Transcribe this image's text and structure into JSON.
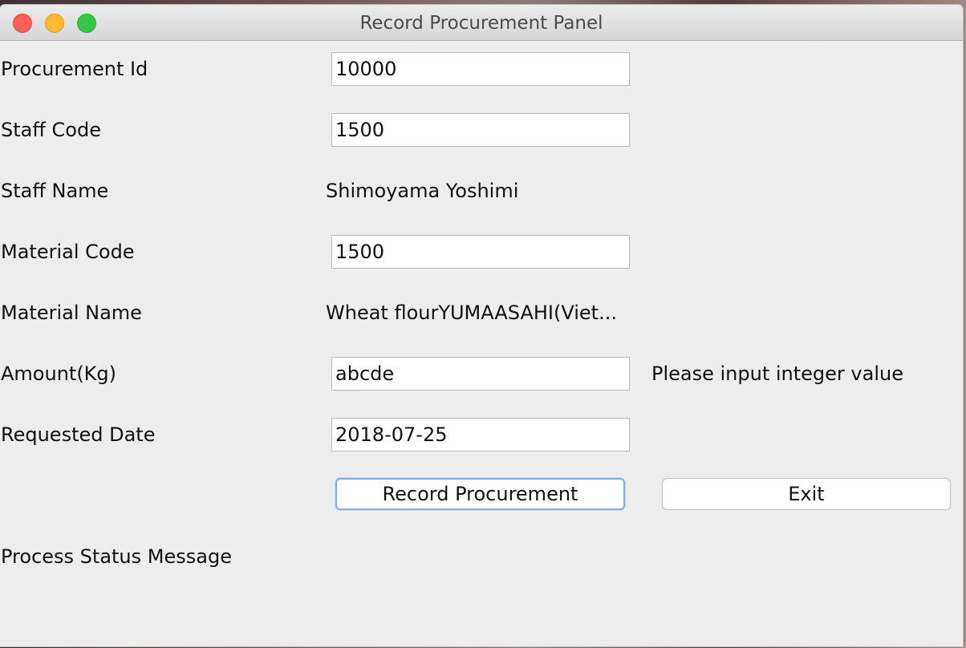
{
  "window": {
    "title": "Record Procurement Panel"
  },
  "form": {
    "procurement_id": {
      "label": "Procurement Id",
      "value": "10000"
    },
    "staff_code": {
      "label": "Staff Code",
      "value": "1500"
    },
    "staff_name": {
      "label": "Staff Name",
      "value": "Shimoyama Yoshimi"
    },
    "material_code": {
      "label": "Material Code",
      "value": "1500"
    },
    "material_name": {
      "label": "Material Name",
      "value": "Wheat flourYUMAASAHI(Viet..."
    },
    "amount": {
      "label": "Amount(Kg)",
      "value": "abcde",
      "hint": "Please input integer value"
    },
    "requested_date": {
      "label": "Requested Date",
      "value": "2018-07-25"
    }
  },
  "actions": {
    "record_label": "Record Procurement",
    "exit_label": "Exit"
  },
  "status": {
    "label": "Process Status Message"
  },
  "colors": {
    "close": "#fc5f57",
    "minimize": "#fdbc2e",
    "zoom": "#33c748",
    "focus_ring": "#80aee8"
  }
}
